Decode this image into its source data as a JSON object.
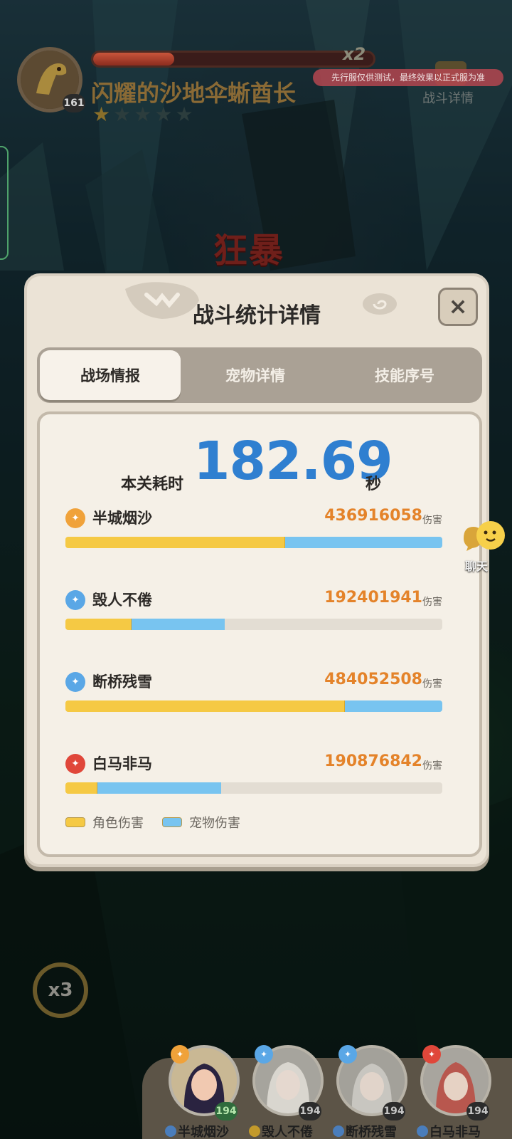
{
  "boss": {
    "name": "闪耀的沙地伞蜥酋长",
    "level": "161",
    "hp_fraction": 0.29,
    "hp_multiplier": "x2",
    "stars_filled": 1,
    "stars_total": 5
  },
  "test_notice": "先行服仅供测试，最终效果以正式服为准",
  "battle_detail_label": "战斗详情",
  "rage_text": "狂暴",
  "panel": {
    "title": "战斗统计详情",
    "close_symbol": "×",
    "tabs": [
      {
        "label": "战场情报",
        "active": true
      },
      {
        "label": "宠物详情",
        "active": false
      },
      {
        "label": "技能序号",
        "active": false
      }
    ],
    "time_label": "本关耗时",
    "time_value": "182.69",
    "time_unit": "秒",
    "damage_unit": "伤害",
    "rows": [
      {
        "name": "半城烟沙",
        "damage": "436916058",
        "element_color": "#f0a23a",
        "char_fraction": 0.583,
        "pet_fraction": 0.417
      },
      {
        "name": "毁人不倦",
        "damage": "192401941",
        "element_color": "#5aa7e6",
        "char_fraction": 0.176,
        "pet_fraction": 0.247
      },
      {
        "name": "断桥残雪",
        "damage": "484052508",
        "element_color": "#5aa7e6",
        "char_fraction": 0.742,
        "pet_fraction": 0.258
      },
      {
        "name": "白马非马",
        "damage": "190876842",
        "element_color": "#e0473a",
        "char_fraction": 0.084,
        "pet_fraction": 0.33
      }
    ],
    "legend": [
      {
        "label": "角色伤害",
        "color": "#f5c944"
      },
      {
        "label": "宠物伤害",
        "color": "#78c4f0"
      }
    ]
  },
  "chat_label": "聊天",
  "speed_label": "x3",
  "team": [
    {
      "name": "半城烟沙",
      "level": "194",
      "element_color": "#f0a23a",
      "shield": "blue"
    },
    {
      "name": "毁人不倦",
      "level": "194",
      "element_color": "#5aa7e6",
      "shield": "gold"
    },
    {
      "name": "断桥残雪",
      "level": "194",
      "element_color": "#5aa7e6",
      "shield": "blue"
    },
    {
      "name": "白马非马",
      "level": "194",
      "element_color": "#e0473a",
      "shield": "blue"
    }
  ]
}
